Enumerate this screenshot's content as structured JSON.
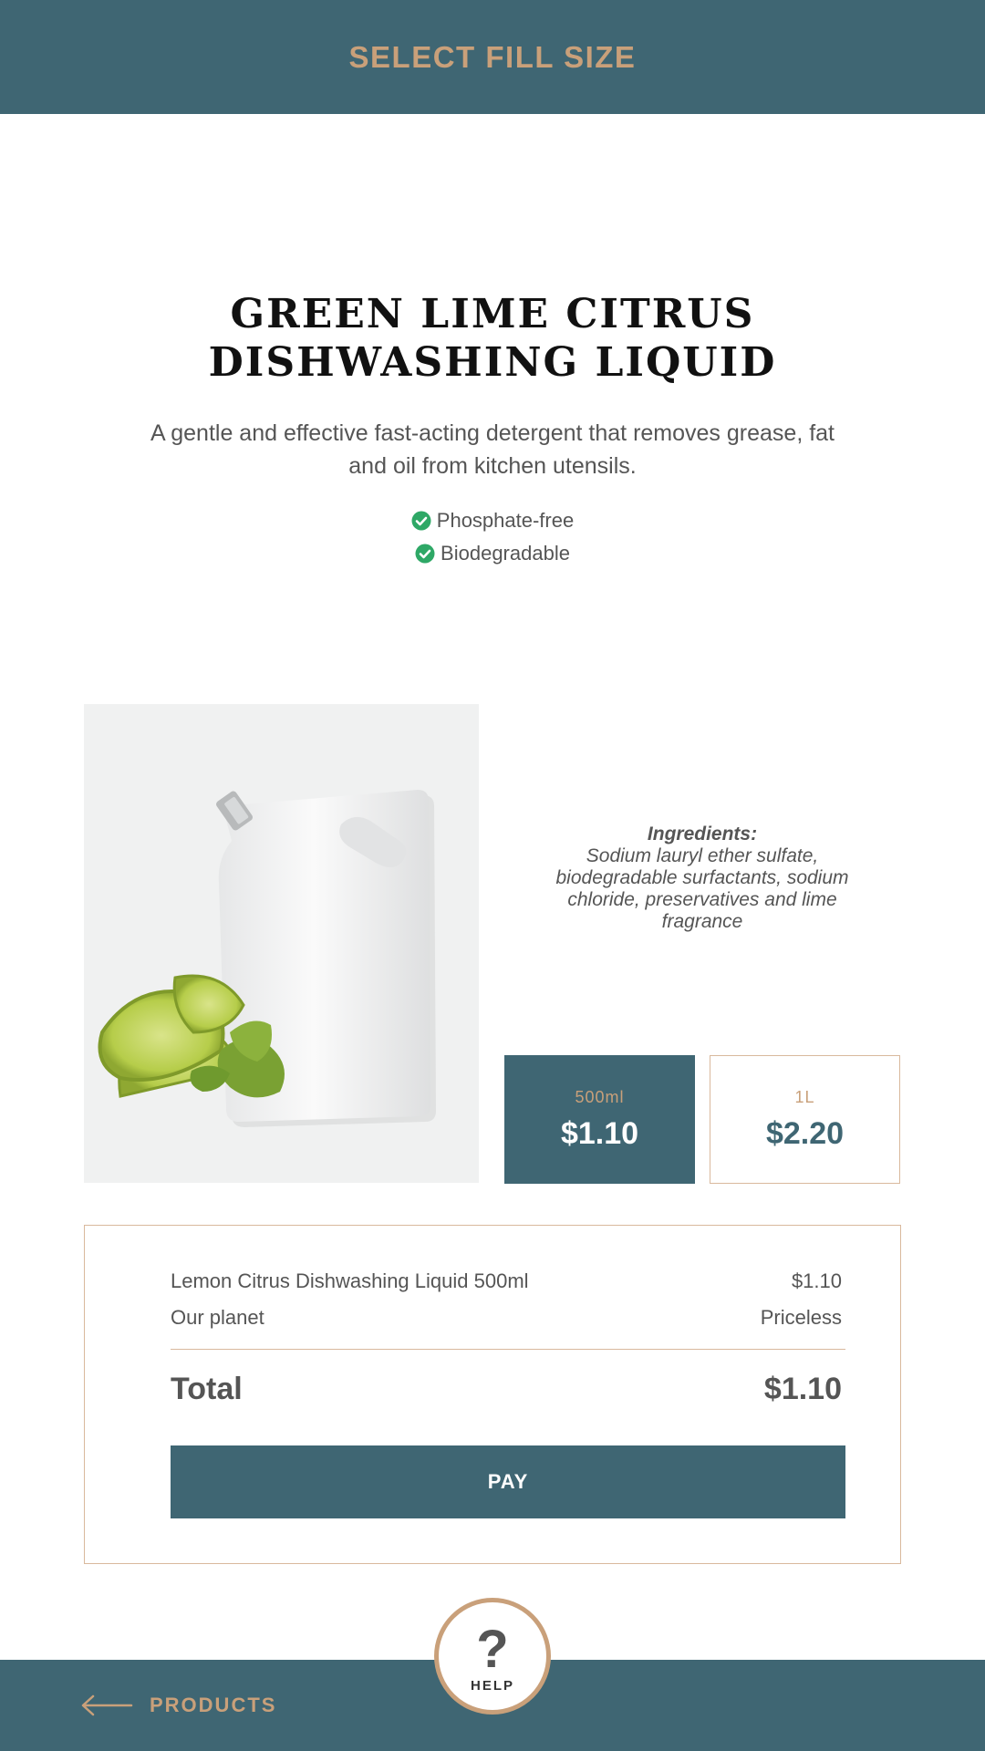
{
  "header": {
    "title": "SELECT FILL SIZE"
  },
  "product": {
    "title_line1": "GREEN LIME CITRUS",
    "title_line2": "DISHWASHING LIQUID",
    "description": "A gentle and effective fast-acting detergent that removes grease, fat and oil from kitchen utensils.",
    "features": [
      "Phosphate-free",
      "Biodegradable"
    ],
    "ingredients_title": "Ingredients:",
    "ingredients_text": "Sodium lauryl ether sulfate, biodegradable surfactants, sodium chloride, preservatives and lime fragrance"
  },
  "sizes": [
    {
      "label": "500ml",
      "price": "$1.10",
      "selected": true
    },
    {
      "label": "1L",
      "price": "$2.20",
      "selected": false
    }
  ],
  "summary": {
    "items": [
      {
        "name": "Lemon Citrus Dishwashing Liquid 500ml",
        "price": "$1.10"
      },
      {
        "name": "Our planet",
        "price": "Priceless"
      }
    ],
    "total_label": "Total",
    "total_value": "$1.10",
    "pay_label": "PAY"
  },
  "footer": {
    "back_label": "PRODUCTS",
    "help_label": "HELP",
    "help_symbol": "?"
  },
  "colors": {
    "primary": "#3f6673",
    "accent": "#c9a07a",
    "check": "#2ea866"
  },
  "icons": [
    "check-circle-icon",
    "arrow-left-icon",
    "question-mark-icon"
  ]
}
